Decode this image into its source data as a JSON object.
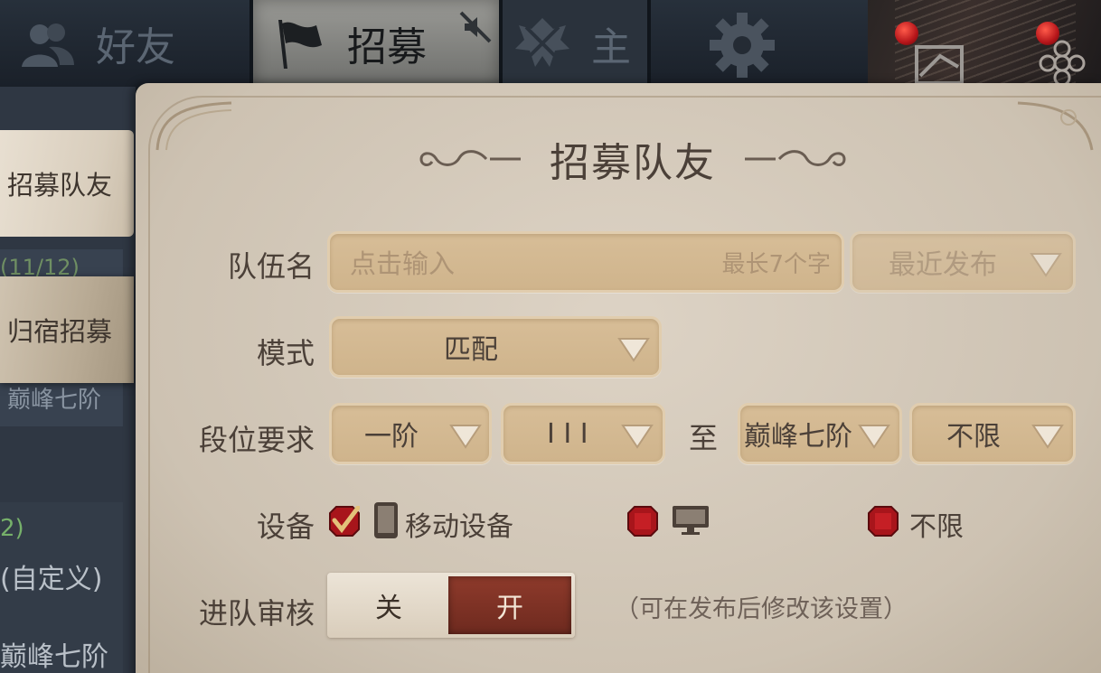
{
  "top_tabs": [
    {
      "label": "好友",
      "icon": "friends-icon"
    },
    {
      "label": "招募",
      "icon": "flag-icon",
      "active": true,
      "badge_icon": "mute-icon"
    },
    {
      "label": "主",
      "icon": "crest-icon"
    }
  ],
  "sidebar": {
    "tabs": [
      "招募队友",
      "归宿招募"
    ],
    "background_texts": {
      "count": "(11/12)",
      "rank_a": "巅峰七阶",
      "count_b": "2)",
      "custom": "(自定义)",
      "rank_b": "巅峰七阶"
    }
  },
  "panel": {
    "title": "招募队友",
    "team_name": {
      "label": "队伍名",
      "placeholder": "点击输入",
      "hint": "最长7个字",
      "sort_value": "最近发布"
    },
    "mode": {
      "label": "模式",
      "value": "匹配"
    },
    "rank": {
      "label": "段位要求",
      "min_tier": "一阶",
      "min_sub": "I I I",
      "to": "至",
      "max_tier": "巅峰七阶",
      "max_sub": "不限"
    },
    "device": {
      "label": "设备",
      "mobile_label": "移动设备",
      "unlimited_label": "不限",
      "options": [
        {
          "name": "mobile",
          "checked": true
        },
        {
          "name": "pc",
          "checked": false
        },
        {
          "name": "unlimited",
          "checked": false
        }
      ]
    },
    "review": {
      "label": "进队审核",
      "off": "关",
      "on": "开",
      "selected": "on",
      "note": "（可在发布后修改该设置）"
    }
  },
  "colors": {
    "parchment": "#d6ccbe",
    "field": "#d3b890",
    "toggle_on": "#7e3325",
    "checkbox_red": "#b4141c",
    "text_dark": "#4b4038"
  }
}
